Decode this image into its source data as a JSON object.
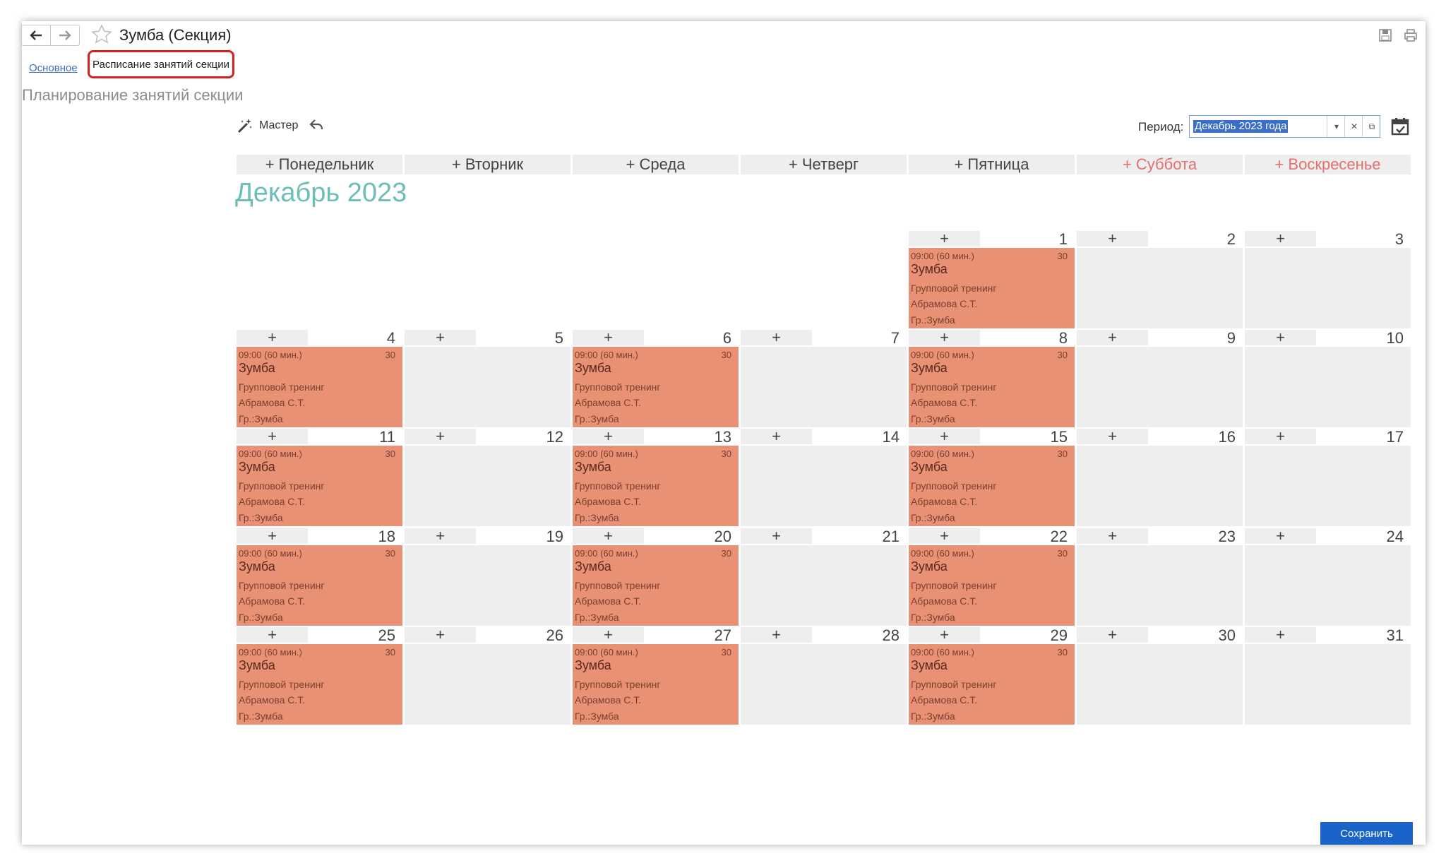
{
  "header": {
    "title": "Зумба (Секция)",
    "back_icon": "arrow-left-icon",
    "forward_icon": "arrow-right-icon",
    "star_icon": "star-icon"
  },
  "tabs": {
    "main": "Основное",
    "schedule": "Расписание занятий секции"
  },
  "page": {
    "subtitle": "Планирование занятий секции"
  },
  "toolbar": {
    "master_label": "Мастер",
    "period_label": "Период:",
    "period_value": "Декабрь 2023 года"
  },
  "calendar": {
    "month_title": "Декабрь 2023",
    "weekdays": [
      "+ Понедельник",
      "+ Вторник",
      "+ Среда",
      "+ Четверг",
      "+ Пятница",
      "+ Суббота",
      "+ Воскресенье"
    ],
    "plus": "+",
    "event": {
      "time": "09:00 (60 мин.)",
      "duration": "30",
      "name": "Зумба",
      "type": "Групповой тренинг",
      "trainer": "Абрамова С.Т.",
      "group": "Гр.:Зумба"
    },
    "event_days": [
      1,
      4,
      6,
      8,
      11,
      13,
      15,
      18,
      20,
      22,
      25,
      27,
      29
    ],
    "colors": {
      "event_bg": "#e99175",
      "month_title": "#6dbdb8",
      "weekend": "#e36f6f"
    }
  },
  "footer": {
    "save_label": "Сохранить"
  }
}
